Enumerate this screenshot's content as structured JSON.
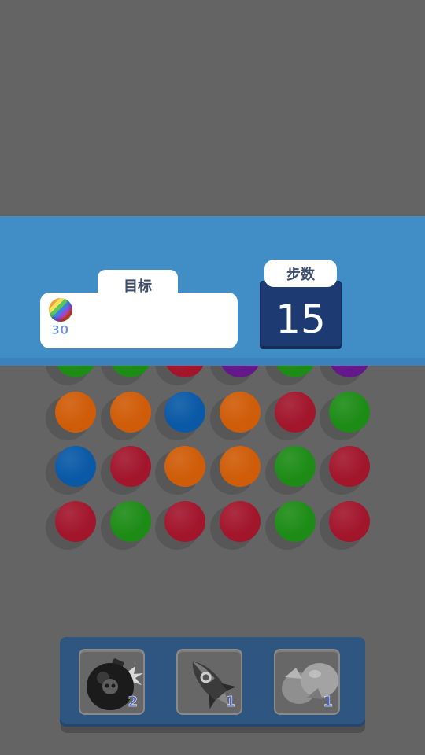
{
  "header": {
    "goal_label": "目标",
    "goal_item": {
      "icon": "rainbow-ball-icon",
      "count": "30"
    },
    "moves_label": "步数",
    "moves_value": "15"
  },
  "board": {
    "colors": {
      "orange": "#cf5c08",
      "red": "#a2162c",
      "blue": "#0959a6",
      "green": "#1d8c16",
      "purple": "#64198a"
    },
    "rows": [
      [
        "green",
        "green",
        "red",
        "purple",
        "green",
        "purple"
      ],
      [
        "orange",
        "orange",
        "blue",
        "orange",
        "red",
        "green"
      ],
      [
        "blue",
        "red",
        "orange",
        "orange",
        "green",
        "red"
      ],
      [
        "red",
        "green",
        "red",
        "red",
        "green",
        "red"
      ]
    ]
  },
  "toolbar": {
    "items": [
      {
        "name": "bomb",
        "icon": "bomb-icon",
        "count": "2"
      },
      {
        "name": "rocket",
        "icon": "rocket-icon",
        "count": "1"
      },
      {
        "name": "hammer",
        "icon": "hammer-icon",
        "count": "1"
      }
    ]
  }
}
